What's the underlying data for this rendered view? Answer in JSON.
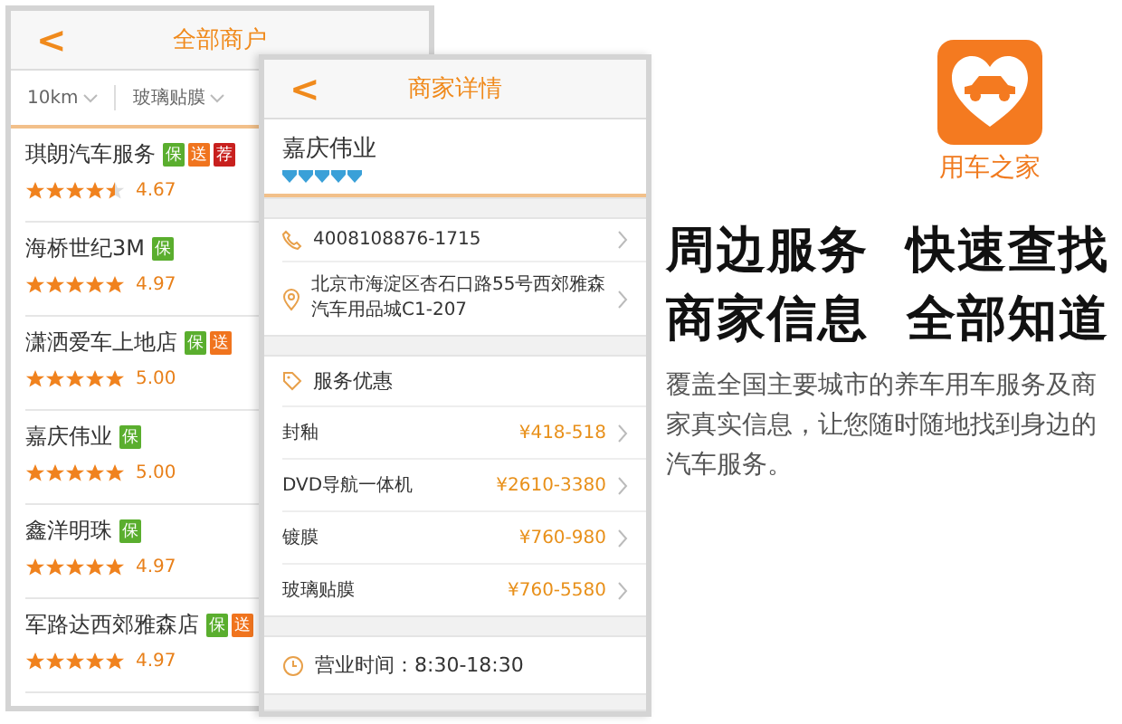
{
  "list_screen": {
    "back": "<",
    "title": "全部商户",
    "filters": [
      "10km",
      "玻璃贴膜"
    ],
    "merchants": [
      {
        "name": "琪朗汽车服务",
        "badges": [
          {
            "text": "保",
            "color": "#5aae2e"
          },
          {
            "text": "送",
            "color": "#f0741e"
          },
          {
            "text": "荐",
            "color": "#c8201e"
          }
        ],
        "stars": 4.5,
        "score": "4.67"
      },
      {
        "name": "海桥世纪3M",
        "badges": [
          {
            "text": "保",
            "color": "#5aae2e"
          }
        ],
        "stars": 5,
        "score": "4.97"
      },
      {
        "name": "潇洒爱车上地店",
        "badges": [
          {
            "text": "保",
            "color": "#5aae2e"
          },
          {
            "text": "送",
            "color": "#f0741e"
          }
        ],
        "stars": 5,
        "score": "5.00"
      },
      {
        "name": "嘉庆伟业",
        "badges": [
          {
            "text": "保",
            "color": "#5aae2e"
          }
        ],
        "stars": 5,
        "score": "5.00"
      },
      {
        "name": "鑫洋明珠",
        "badges": [
          {
            "text": "保",
            "color": "#5aae2e"
          }
        ],
        "stars": 5,
        "score": "4.97"
      },
      {
        "name": "军路达西郊雅森店",
        "badges": [
          {
            "text": "保",
            "color": "#5aae2e"
          },
          {
            "text": "送",
            "color": "#f0741e"
          }
        ],
        "stars": 5,
        "score": "4.97"
      }
    ]
  },
  "detail_screen": {
    "back": "<",
    "title": "商家详情",
    "name": "嘉庆伟业",
    "stars": 5,
    "phone": "4008108876-1715",
    "address": "北京市海淀区杏石口路55号西郊雅森汽车用品城C1-207",
    "services_title": "服务优惠",
    "services": [
      {
        "name": "封釉",
        "price": "¥418-518"
      },
      {
        "name": "DVD导航一体机",
        "price": "¥2610-3380"
      },
      {
        "name": "镀膜",
        "price": "¥760-980"
      },
      {
        "name": "玻璃贴膜",
        "price": "¥760-5580"
      }
    ],
    "hours": "营业时间：8:30-18:30"
  },
  "promo": {
    "app_name": "用车之家",
    "headlines": [
      "周边服务  快速查找",
      "商家信息  全部知道"
    ],
    "description": "覆盖全国主要城市的养车用车服务及商家真实信息，让您随时随地找到身边的汽车服务。"
  }
}
